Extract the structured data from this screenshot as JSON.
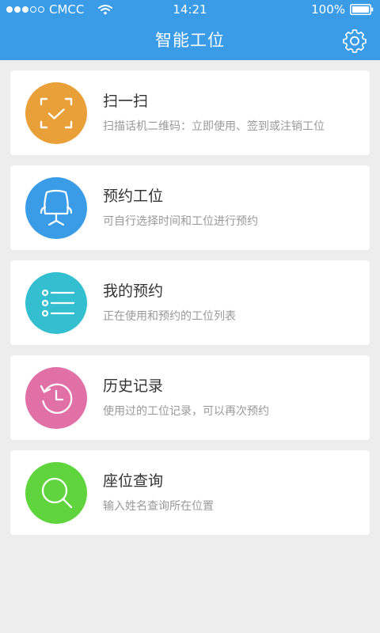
{
  "status_bar": {
    "carrier": "CMCC",
    "time": "14:21",
    "battery": "100%",
    "signal_bars": 3,
    "signal_total": 5
  },
  "header": {
    "title": "智能工位"
  },
  "colors": {
    "header": "#3a9be7",
    "background": "#ededed",
    "scan": "#e9a039",
    "reserve": "#3a9be7",
    "my_reservations": "#34bfd0",
    "history": "#e070a5",
    "search": "#5fd43d"
  },
  "menu": [
    {
      "key": "scan",
      "icon": "scan-check-icon",
      "title": "扫一扫",
      "desc": "扫描话机二维码：立即使用、签到或注销工位"
    },
    {
      "key": "reserve",
      "icon": "office-chair-icon",
      "title": "预约工位",
      "desc": "可自行选择时间和工位进行预约"
    },
    {
      "key": "my_reservations",
      "icon": "list-icon",
      "title": "我的预约",
      "desc": "正在使用和预约的工位列表"
    },
    {
      "key": "history",
      "icon": "history-clock-icon",
      "title": "历史记录",
      "desc": "使用过的工位记录，可以再次预约"
    },
    {
      "key": "search",
      "icon": "magnifier-icon",
      "title": "座位查询",
      "desc": "输入姓名查询所在位置"
    }
  ]
}
